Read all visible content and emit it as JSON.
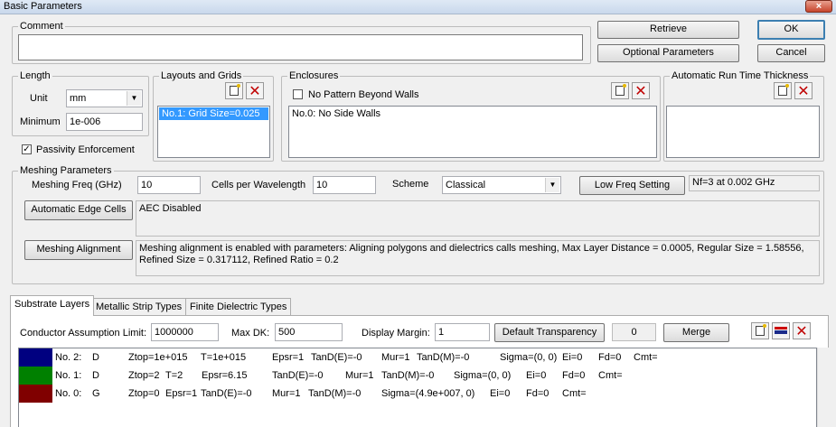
{
  "window": {
    "title": "Basic Parameters",
    "close": "×"
  },
  "comment": {
    "legend": "Comment",
    "value": ""
  },
  "buttons": {
    "retrieve": "Retrieve",
    "ok": "OK",
    "optional_parameters": "Optional Parameters",
    "cancel": "Cancel",
    "low_freq_setting": "Low Freq Setting",
    "automatic_edge_cells": "Automatic Edge Cells",
    "meshing_alignment": "Meshing Alignment",
    "default_transparency": "Default Transparency",
    "merge": "Merge"
  },
  "length": {
    "legend": "Length",
    "unit_label": "Unit",
    "unit_value": "mm",
    "minimum_label": "Minimum",
    "minimum_value": "1e-006"
  },
  "passivity": {
    "label": "Passivity Enforcement",
    "checked": "✓"
  },
  "layouts": {
    "legend": "Layouts and Grids",
    "items": [
      "No.1: Grid Size=0.025"
    ]
  },
  "enclosures": {
    "legend": "Enclosures",
    "no_pattern_label": "No Pattern Beyond Walls",
    "items": [
      "No.0: No Side Walls"
    ]
  },
  "auto_run_time": {
    "legend": "Automatic Run Time Thickness"
  },
  "meshing": {
    "legend": "Meshing Parameters",
    "freq_label": "Meshing Freq (GHz)",
    "freq_value": "10",
    "cpw_label": "Cells per Wavelength",
    "cpw_value": "10",
    "scheme_label": "Scheme",
    "scheme_value": "Classical",
    "low_freq_info": "Nf=3 at 0.002 GHz",
    "aec_info": "AEC Disabled",
    "alignment_info": "Meshing alignment is enabled with parameters: Aligning polygons and dielectrics calls meshing, Max Layer Distance = 0.0005, Regular Size = 1.58556, Refined Size = 0.317112, Refined Ratio = 0.2"
  },
  "tabs": [
    "Substrate Layers",
    "Metallic Strip Types",
    "Finite Dielectric Types"
  ],
  "substrate": {
    "conductor_limit_label": "Conductor Assumption Limit:",
    "conductor_limit_value": "1000000",
    "max_dk_label": "Max DK:",
    "max_dk_value": "500",
    "display_margin_label": "Display Margin:",
    "display_margin_value": "1",
    "transparency_value": "0",
    "layers": [
      {
        "color": "#000080",
        "cells": [
          "No. 2:",
          "D",
          "Ztop=1e+015",
          "T=1e+015",
          "Epsr=1",
          "TanD(E)=-0",
          "Mur=1",
          "TanD(M)=-0",
          "Sigma=(0, 0)",
          "Ei=0",
          "Fd=0",
          "Cmt="
        ]
      },
      {
        "color": "#008000",
        "cells": [
          "No. 1:",
          "D",
          "Ztop=2",
          "T=2",
          "Epsr=6.15",
          "TanD(E)=-0",
          "Mur=1",
          "TanD(M)=-0",
          "Sigma=(0, 0)",
          "Ei=0",
          "Fd=0",
          "Cmt="
        ]
      },
      {
        "color": "#800000",
        "cells": [
          "No. 0:",
          "G",
          "Ztop=0",
          "Epsr=1",
          "TanD(E)=-0",
          "Mur=1",
          "TanD(M)=-0",
          "Sigma=(4.9e+007, 0)",
          "Ei=0",
          "Fd=0",
          "Cmt="
        ]
      }
    ]
  }
}
